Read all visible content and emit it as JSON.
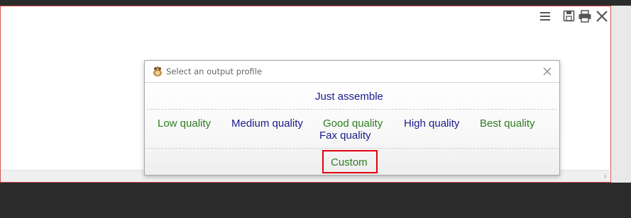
{
  "toolbar": {
    "icons": [
      "menu-icon",
      "save-icon",
      "print-icon",
      "close-icon"
    ]
  },
  "dialog": {
    "title": "Select an output profile",
    "logo_icon": "app-logo-icon",
    "close_icon": "close-icon",
    "options": {
      "just_assemble": "Just assemble",
      "low": "Low quality",
      "medium": "Medium quality",
      "good": "Good quality",
      "high": "High quality",
      "best": "Best quality",
      "fax": "Fax quality",
      "custom": "Custom"
    },
    "colors": {
      "blue_option": "#1a1a8c",
      "green_option": "#2e7d1e",
      "highlight": "#e0000a"
    }
  },
  "panel": {
    "scroll_arrow": "›"
  }
}
